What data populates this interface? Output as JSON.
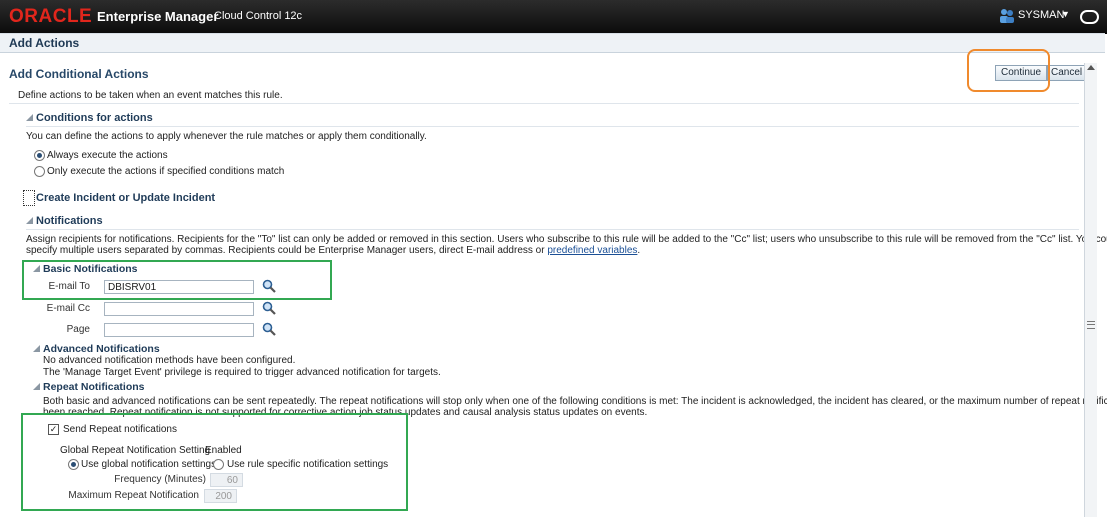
{
  "brand": {
    "logo": "ORACLE",
    "product": "Enterprise Manager",
    "edition": "Cloud Control 12c"
  },
  "user": {
    "name": "SYSMAN"
  },
  "page_title": "Add Actions",
  "section_title": "Add Conditional Actions",
  "buttons": {
    "continue": "Continue",
    "cancel": "Cancel"
  },
  "intro": "Define actions to be taken when an event matches this rule.",
  "conditions": {
    "title": "Conditions for actions",
    "desc": "You can define the actions to apply whenever the rule matches or apply them conditionally.",
    "options": [
      "Always execute the actions",
      "Only execute the actions if specified conditions match"
    ],
    "selected": 0
  },
  "incident": {
    "title": "Create Incident or Update Incident"
  },
  "notifications": {
    "title": "Notifications",
    "desc_line1": "Assign recipients for notifications. Recipients for the \"To\" list can only be added or removed in this section. Users who subscribe to this rule will be added to the \"Cc\" list; users who unsubscribe to this rule will be removed from the \"Cc\" list. You could",
    "desc_line2": "specify multiple users separated by commas. Recipients could be Enterprise Manager users, direct E-mail address or ",
    "desc_link": "predefined variables",
    "desc_end": "."
  },
  "basic": {
    "title": "Basic Notifications",
    "email_to_label": "E-mail To",
    "email_to_value": "DBISRV01",
    "email_cc_label": "E-mail Cc",
    "email_cc_value": "",
    "page_label": "Page",
    "page_value": ""
  },
  "advanced": {
    "title": "Advanced Notifications",
    "line1": "No advanced notification methods have been configured.",
    "line2": "The 'Manage Target Event' privilege is required to trigger advanced notification for targets."
  },
  "repeat": {
    "title": "Repeat Notifications",
    "line1": "Both basic and advanced notifications can be sent repeatedly. The repeat notifications will stop only when one of the following conditions is met: The incident is acknowledged, the incident has cleared, or the maximum number of repeat notifications has",
    "line2": "been reached. Repeat notification is not supported for corrective action job status updates and causal analysis status updates on events.",
    "send_label": "Send Repeat notifications",
    "send_checked": true,
    "global_label": "Global Repeat Notification Setting",
    "global_value": "Enabled",
    "use_global": "Use global notification settings",
    "use_rule": "Use rule specific notification settings",
    "frequency_label": "Frequency (Minutes)",
    "frequency_value": "60",
    "max_label": "Maximum Repeat Notification",
    "max_value": "200"
  },
  "highlight_colors": {
    "basic_box": "#32a852",
    "repeat_box": "#32a852",
    "continue_box": "#f08a2d"
  }
}
